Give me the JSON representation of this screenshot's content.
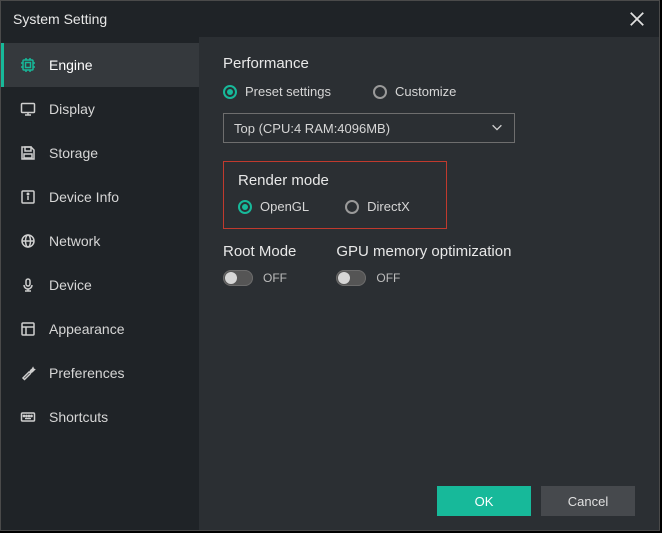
{
  "window": {
    "title": "System Setting"
  },
  "sidebar": {
    "items": [
      {
        "label": "Engine"
      },
      {
        "label": "Display"
      },
      {
        "label": "Storage"
      },
      {
        "label": "Device Info"
      },
      {
        "label": "Network"
      },
      {
        "label": "Device"
      },
      {
        "label": "Appearance"
      },
      {
        "label": "Preferences"
      },
      {
        "label": "Shortcuts"
      }
    ]
  },
  "performance": {
    "title": "Performance",
    "preset_label": "Preset settings",
    "customize_label": "Customize",
    "preset_selected": "Top (CPU:4 RAM:4096MB)"
  },
  "render": {
    "title": "Render mode",
    "opengl_label": "OpenGL",
    "directx_label": "DirectX"
  },
  "root": {
    "title": "Root Mode",
    "state": "OFF"
  },
  "gpu": {
    "title": "GPU memory optimization",
    "state": "OFF"
  },
  "buttons": {
    "ok": "OK",
    "cancel": "Cancel"
  },
  "colors": {
    "accent": "#17b99a",
    "highlight_border": "#c03a2e"
  }
}
